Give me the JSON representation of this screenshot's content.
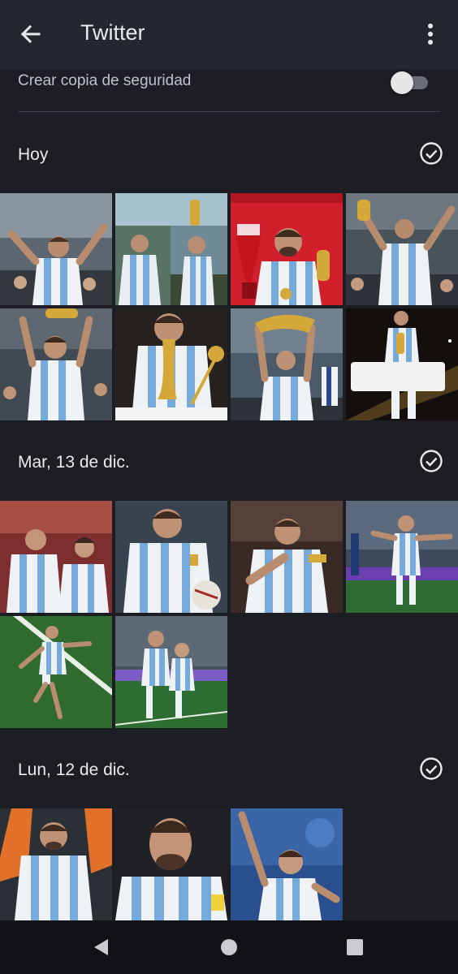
{
  "appbar": {
    "title": "Twitter",
    "back_icon": "arrow-back-icon",
    "menu_icon": "more-vert-icon"
  },
  "backup": {
    "label": "Crear copia de seguridad",
    "enabled": false
  },
  "sections": [
    {
      "label": "Hoy",
      "photo_count": 8
    },
    {
      "label": "Mar, 13 de dic.",
      "photo_count": 6
    },
    {
      "label": "Lun, 12 de dic.",
      "photo_count": 3
    }
  ],
  "colors": {
    "background": "#1c1e23",
    "appbar": "#24272d",
    "jersey_blue": "#75aadb",
    "trophy_gold": "#d4a93a",
    "banner_red": "#d11f2b",
    "pitch_green": "#2e6b2f",
    "orange_jersey": "#e0702a"
  },
  "navbar": {
    "back_icon": "nav-back-triangle-icon",
    "home_icon": "nav-home-circle-icon",
    "recents_icon": "nav-recents-square-icon"
  }
}
